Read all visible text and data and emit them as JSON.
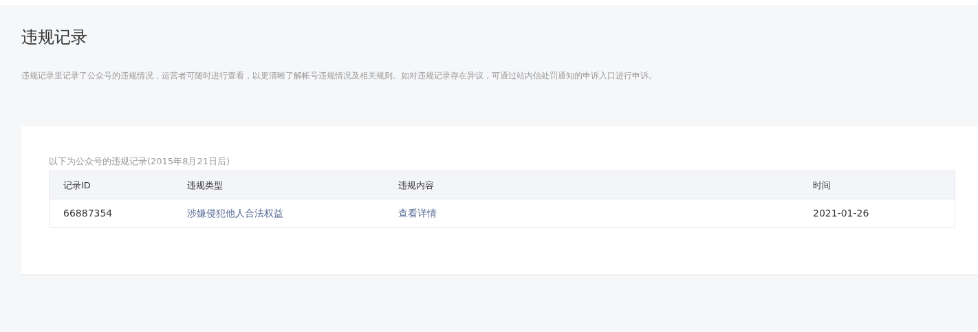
{
  "title": "违规记录",
  "description": "违规记录里记录了公众号的违规情况，运营者可随时进行查看，以更清晰了解帐号违规情况及相关规则。如对违规记录存在异议，可通过站内信处罚通知的申诉入口进行申诉。",
  "records": {
    "caption": "以下为公众号的违规记录(2015年8月21日后)",
    "table": {
      "columns": [
        "记录ID",
        "违规类型",
        "违规内容",
        "时间"
      ],
      "rows": [
        [
          {
            "kind": "text",
            "text": "66887354"
          },
          {
            "kind": "link",
            "text": "涉嫌侵犯他人合法权益"
          },
          {
            "kind": "link",
            "text": "查看详情"
          },
          {
            "kind": "text",
            "text": "2021-01-26"
          }
        ]
      ]
    }
  }
}
